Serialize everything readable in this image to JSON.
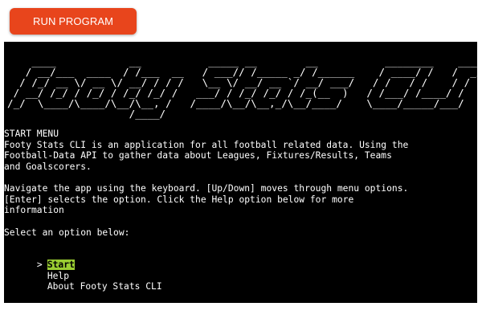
{
  "toolbar": {
    "run_label": "RUN PROGRAM"
  },
  "terminal": {
    "banner": "    ____            __           _____ __        __           ________    ____\n   / __/___  ____  / /___  __   / ___// /_____ _/ /______    / ____/ /   /  _/\n  / /_/ __ \\/ __ \\/ __/ / / /   \\__ \\/ __/ __ `/ __/ ___/   / /   / /    / /\n / __/ /_/ / /_/ / /_/ /_/ /   ___/ / /_/ /_/ / /_(__  )   / /___/ /____/ /\n/_/  \\____/\\____/\\__/\\__, /   /____/\\__/\\__,_/\\__/____/    \\____/_____/___/\n                    /____/",
    "heading": "START MENU",
    "intro_lines": [
      "Footy Stats CLI is an application for all football related data. Using the",
      "Football-Data API to gather data about Leagues, Fixtures/Results, Teams",
      "and Goalscorers."
    ],
    "nav_lines": [
      "Navigate the app using the keyboard. [Up/Down] moves through menu options.",
      "[Enter] selects the option. Click the Help option below for more",
      "information"
    ],
    "prompt": "Select an option below:",
    "pointer": ">",
    "menu": [
      {
        "label": "Start"
      },
      {
        "label": "Help"
      },
      {
        "label": "About Footy Stats CLI"
      }
    ],
    "selected_color": "#9acd32"
  }
}
